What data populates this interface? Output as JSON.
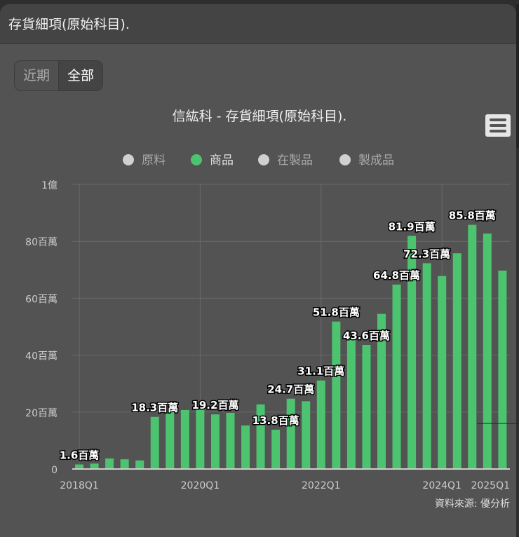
{
  "header": {
    "title": "存貨細項(原始科目)."
  },
  "range_buttons": [
    {
      "label": "近期",
      "active": false
    },
    {
      "label": "全部",
      "active": true
    }
  ],
  "colors": {
    "bar": "#4cc46f",
    "hidden": "#d0d0d0"
  },
  "chart_data": {
    "type": "bar",
    "title": "信紘科 - 存貨細項(原始科目).",
    "legend": [
      {
        "name": "原料",
        "visible": false
      },
      {
        "name": "商品",
        "visible": true
      },
      {
        "name": "在製品",
        "visible": false
      },
      {
        "name": "製成品",
        "visible": false
      }
    ],
    "legend_position": "top-center",
    "categories": [
      "2018Q1",
      "2018Q2",
      "2018Q3",
      "2018Q4",
      "2019Q1",
      "2019Q2",
      "2019Q3",
      "2019Q4",
      "2020Q1",
      "2020Q2",
      "2020Q3",
      "2020Q4",
      "2021Q1",
      "2021Q2",
      "2021Q3",
      "2021Q4",
      "2022Q1",
      "2022Q2",
      "2022Q3",
      "2022Q4",
      "2023Q1",
      "2023Q2",
      "2023Q3",
      "2023Q4",
      "2024Q1",
      "2024Q2",
      "2024Q3",
      "2024Q4",
      "2025Q1"
    ],
    "series": [
      {
        "name": "商品",
        "values": [
          1.6,
          1.9,
          3.7,
          3.4,
          3.0,
          18.3,
          21.7,
          20.7,
          21.0,
          19.2,
          19.7,
          15.3,
          22.7,
          13.8,
          24.7,
          23.8,
          31.1,
          51.8,
          47.0,
          43.6,
          54.5,
          64.8,
          81.9,
          72.3,
          67.8,
          75.8,
          85.8,
          82.7,
          69.7
        ]
      }
    ],
    "data_labels": [
      {
        "index": 0,
        "text": "1.6百萬"
      },
      {
        "index": 5,
        "text": "18.3百萬"
      },
      {
        "index": 9,
        "text": "19.2百萬"
      },
      {
        "index": 13,
        "text": "13.8百萬"
      },
      {
        "index": 14,
        "text": "24.7百萬"
      },
      {
        "index": 16,
        "text": "31.1百萬"
      },
      {
        "index": 17,
        "text": "51.8百萬"
      },
      {
        "index": 19,
        "text": "43.6百萬"
      },
      {
        "index": 21,
        "text": "64.8百萬"
      },
      {
        "index": 22,
        "text": "81.9百萬"
      },
      {
        "index": 23,
        "text": "72.3百萬"
      },
      {
        "index": 26,
        "text": "85.8百萬"
      }
    ],
    "unit": "百萬",
    "ylim": [
      0,
      100
    ],
    "yticks": [
      {
        "value": 0,
        "label": "0"
      },
      {
        "value": 20,
        "label": "20百萬"
      },
      {
        "value": 40,
        "label": "40百萬"
      },
      {
        "value": 60,
        "label": "60百萬"
      },
      {
        "value": 80,
        "label": "80百萬"
      },
      {
        "value": 100,
        "label": "1億"
      }
    ],
    "xticks": [
      {
        "index": 0,
        "label": "2018Q1"
      },
      {
        "index": 8,
        "label": "2020Q1"
      },
      {
        "index": 16,
        "label": "2022Q1"
      },
      {
        "index": 24,
        "label": "2024Q1"
      },
      {
        "index": 28,
        "label": "2025Q1"
      }
    ],
    "grid": true,
    "credit": "資料來源: 優分析"
  }
}
